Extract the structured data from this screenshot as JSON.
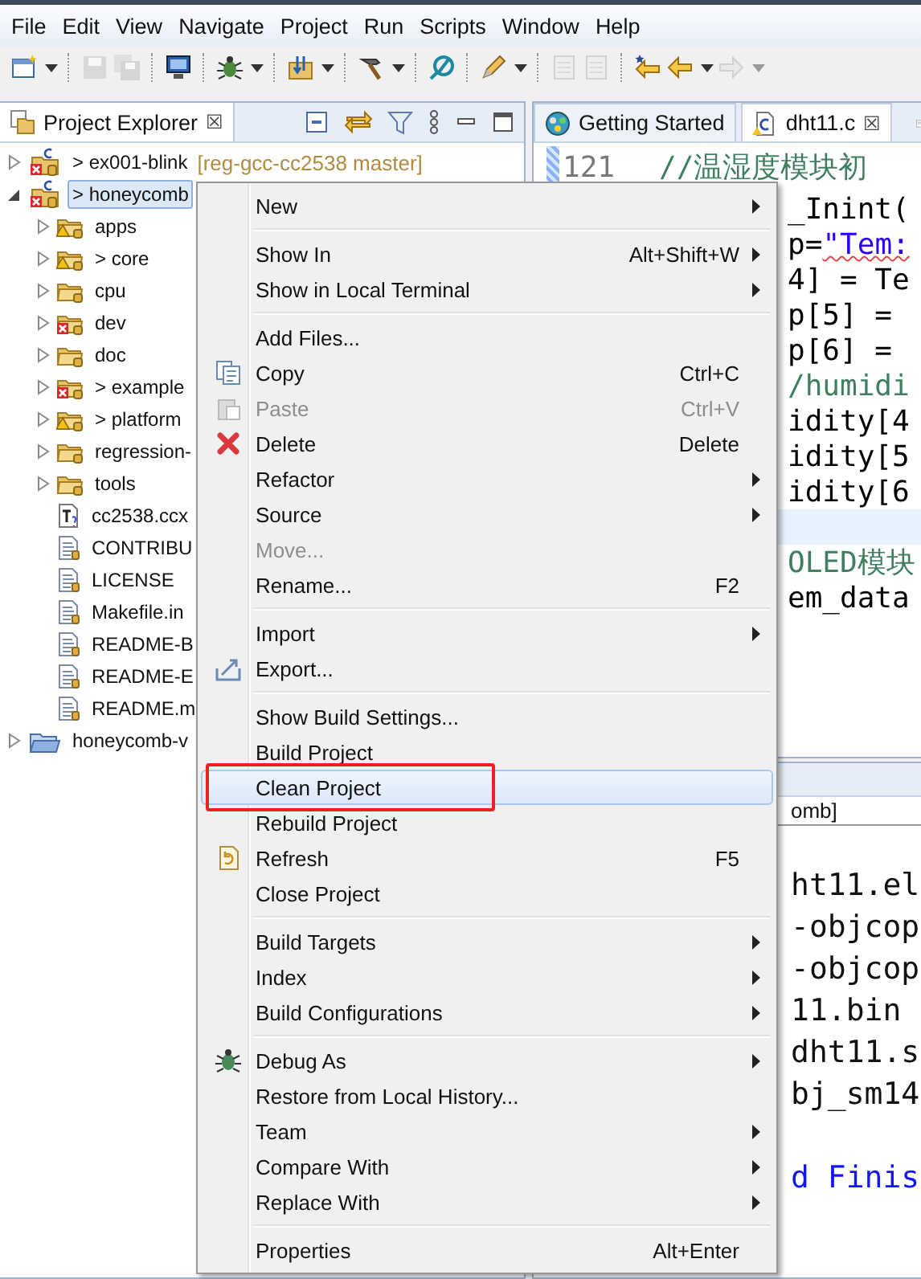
{
  "menubar": [
    "File",
    "Edit",
    "View",
    "Navigate",
    "Project",
    "Run",
    "Scripts",
    "Window",
    "Help"
  ],
  "toolbar": [
    {
      "kind": "button",
      "disabled": false,
      "dropdown": true
    },
    {
      "kind": "separator"
    },
    {
      "kind": "button",
      "disabled": true,
      "dropdown": false
    },
    {
      "kind": "button",
      "disabled": true,
      "dropdown": false
    },
    {
      "kind": "separator"
    },
    {
      "kind": "button",
      "disabled": false,
      "dropdown": false
    },
    {
      "kind": "separator"
    },
    {
      "kind": "button",
      "disabled": false,
      "dropdown": true
    },
    {
      "kind": "separator"
    },
    {
      "kind": "button",
      "disabled": false,
      "dropdown": true
    },
    {
      "kind": "separator"
    },
    {
      "kind": "button",
      "disabled": false,
      "dropdown": true
    },
    {
      "kind": "separator"
    },
    {
      "kind": "button",
      "disabled": false,
      "dropdown": false
    },
    {
      "kind": "separator"
    },
    {
      "kind": "button",
      "disabled": false,
      "dropdown": true
    },
    {
      "kind": "separator"
    },
    {
      "kind": "button",
      "disabled": true,
      "dropdown": false
    },
    {
      "kind": "button",
      "disabled": true,
      "dropdown": false
    },
    {
      "kind": "separator"
    },
    {
      "kind": "button",
      "disabled": false,
      "dropdown": false
    },
    {
      "kind": "button",
      "disabled": false,
      "dropdown": true
    },
    {
      "kind": "button",
      "disabled": true,
      "dropdown": true
    }
  ],
  "project_explorer": {
    "title": "Project Explorer",
    "close": "☒",
    "tree": [
      {
        "kind": "project",
        "label": "> ex001-blink",
        "decoration": "[reg-gcc-cc2538 master]",
        "expanded": false,
        "selected": false
      },
      {
        "kind": "project",
        "label": "> honeycomb",
        "expanded": true,
        "selected": true,
        "children": [
          {
            "kind": "folder",
            "error": false,
            "warning": true,
            "label": "apps",
            "expanded": false,
            "selected": false
          },
          {
            "kind": "folder",
            "error": false,
            "warning": true,
            "label": "> core",
            "expanded": false,
            "selected": false
          },
          {
            "kind": "folder",
            "error": false,
            "warning": false,
            "label": "cpu",
            "expanded": false,
            "selected": false
          },
          {
            "kind": "folder",
            "error": true,
            "warning": false,
            "label": "dev",
            "expanded": false,
            "selected": false
          },
          {
            "kind": "folder",
            "error": false,
            "warning": false,
            "label": "doc",
            "expanded": false,
            "selected": false
          },
          {
            "kind": "folder",
            "error": true,
            "warning": false,
            "label": "> example",
            "expanded": false,
            "selected": false
          },
          {
            "kind": "folder",
            "error": false,
            "warning": true,
            "label": "> platform",
            "expanded": false,
            "selected": false
          },
          {
            "kind": "folder",
            "error": false,
            "warning": false,
            "label": "regression-",
            "expanded": false,
            "selected": false
          },
          {
            "kind": "folder",
            "error": false,
            "warning": false,
            "label": "tools",
            "expanded": false,
            "selected": false
          },
          {
            "kind": "target",
            "label": "cc2538.ccx",
            "selected": false
          },
          {
            "kind": "file",
            "label": "CONTRIBU",
            "selected": false
          },
          {
            "kind": "file",
            "label": "LICENSE",
            "selected": false
          },
          {
            "kind": "file",
            "label": "Makefile.in",
            "selected": false
          },
          {
            "kind": "file",
            "label": "README-B",
            "selected": false
          },
          {
            "kind": "file",
            "label": "README-E",
            "selected": false
          },
          {
            "kind": "file",
            "label": "README.m",
            "selected": false
          }
        ]
      },
      {
        "kind": "open-project",
        "label": "honeycomb-v",
        "expanded": false,
        "selected": false
      }
    ]
  },
  "editor": {
    "tabs": [
      {
        "label": "Getting Started",
        "selected": false
      },
      {
        "label": "dht11.c",
        "close": "☒",
        "selected": true
      }
    ],
    "first_line": {
      "number": "121",
      "segments": [
        {
          "text": "//温湿度模块初",
          "kind": "comment"
        }
      ]
    },
    "lines": [
      {
        "segments": [
          {
            "text": "_Inint(",
            "kind": "code"
          }
        ],
        "current": false
      },
      {
        "segments": [
          {
            "text": "p=",
            "kind": "code"
          },
          {
            "text": "\"Tem:",
            "kind": "string"
          }
        ],
        "current": false
      },
      {
        "segments": [
          {
            "text": "4] = Te",
            "kind": "code"
          }
        ],
        "current": false
      },
      {
        "segments": [
          {
            "text": "p[5] = ",
            "kind": "code"
          }
        ],
        "current": false
      },
      {
        "segments": [
          {
            "text": "p[6] = ",
            "kind": "code"
          }
        ],
        "current": false
      },
      {
        "segments": [
          {
            "text": "/humidi",
            "kind": "comment"
          }
        ],
        "current": false
      },
      {
        "segments": [
          {
            "text": "idity[4",
            "kind": "code"
          }
        ],
        "current": false
      },
      {
        "segments": [
          {
            "text": "idity[5",
            "kind": "code"
          }
        ],
        "current": false
      },
      {
        "segments": [
          {
            "text": "idity[6",
            "kind": "code"
          }
        ],
        "current": false
      },
      {
        "current": true
      },
      {
        "segments": [
          {
            "text": "OLED模块",
            "kind": "comment"
          }
        ],
        "current": false
      },
      {
        "segments": [
          {
            "text": "em_data",
            "kind": "code"
          }
        ],
        "current": false
      }
    ]
  },
  "console": {
    "title": "omb]",
    "lines": [
      {
        "text": "ht11.el",
        "kind": "normal"
      },
      {
        "text": "-objcop",
        "kind": "normal"
      },
      {
        "text": "-objcop",
        "kind": "normal"
      },
      {
        "text": "11.bin",
        "kind": "normal"
      },
      {
        "text": "dht11.s",
        "kind": "normal"
      },
      {
        "text": "bj_sm14",
        "kind": "normal"
      },
      {
        "kind": "blank"
      },
      {
        "text": "d Finis",
        "kind": "info"
      }
    ]
  },
  "context_menu": [
    {
      "kind": "item",
      "label": "New",
      "submenu": true,
      "disabled": false,
      "selected": false
    },
    {
      "kind": "separator"
    },
    {
      "kind": "item",
      "label": "Show In",
      "shortcut": "Alt+Shift+W",
      "submenu": true,
      "disabled": false,
      "selected": false
    },
    {
      "kind": "item",
      "label": "Show in Local Terminal",
      "submenu": true,
      "disabled": false,
      "selected": false
    },
    {
      "kind": "separator"
    },
    {
      "kind": "item",
      "label": "Add Files...",
      "submenu": false,
      "disabled": false,
      "selected": false
    },
    {
      "kind": "item",
      "label": "Copy",
      "shortcut": "Ctrl+C",
      "submenu": false,
      "disabled": false,
      "selected": false
    },
    {
      "kind": "item",
      "label": "Paste",
      "shortcut": "Ctrl+V",
      "submenu": false,
      "disabled": true,
      "selected": false
    },
    {
      "kind": "item",
      "label": "Delete",
      "shortcut": "Delete",
      "submenu": false,
      "disabled": false,
      "selected": false
    },
    {
      "kind": "item",
      "label": "Refactor",
      "submenu": true,
      "disabled": false,
      "selected": false
    },
    {
      "kind": "item",
      "label": "Source",
      "submenu": true,
      "disabled": false,
      "selected": false
    },
    {
      "kind": "item",
      "label": "Move...",
      "submenu": false,
      "disabled": true,
      "selected": false
    },
    {
      "kind": "item",
      "label": "Rename...",
      "shortcut": "F2",
      "submenu": false,
      "disabled": false,
      "selected": false
    },
    {
      "kind": "separator"
    },
    {
      "kind": "item",
      "label": "Import",
      "submenu": true,
      "disabled": false,
      "selected": false
    },
    {
      "kind": "item",
      "label": "Export...",
      "submenu": false,
      "disabled": false,
      "selected": false
    },
    {
      "kind": "separator"
    },
    {
      "kind": "item",
      "label": "Show Build Settings...",
      "submenu": false,
      "disabled": false,
      "selected": false
    },
    {
      "kind": "item",
      "label": "Build Project",
      "submenu": false,
      "disabled": false,
      "selected": false
    },
    {
      "kind": "item",
      "label": "Clean Project",
      "submenu": false,
      "disabled": false,
      "selected": true,
      "annotated": true
    },
    {
      "kind": "item",
      "label": "Rebuild Project",
      "submenu": false,
      "disabled": false,
      "selected": false
    },
    {
      "kind": "item",
      "label": "Refresh",
      "shortcut": "F5",
      "submenu": false,
      "disabled": false,
      "selected": false
    },
    {
      "kind": "item",
      "label": "Close Project",
      "submenu": false,
      "disabled": false,
      "selected": false
    },
    {
      "kind": "separator"
    },
    {
      "kind": "item",
      "label": "Build Targets",
      "submenu": true,
      "disabled": false,
      "selected": false
    },
    {
      "kind": "item",
      "label": "Index",
      "submenu": true,
      "disabled": false,
      "selected": false
    },
    {
      "kind": "item",
      "label": "Build Configurations",
      "submenu": true,
      "disabled": false,
      "selected": false
    },
    {
      "kind": "separator"
    },
    {
      "kind": "item",
      "label": "Debug As",
      "submenu": true,
      "disabled": false,
      "selected": false
    },
    {
      "kind": "item",
      "label": "Restore from Local History...",
      "submenu": false,
      "disabled": false,
      "selected": false
    },
    {
      "kind": "item",
      "label": "Team",
      "submenu": true,
      "disabled": false,
      "selected": false
    },
    {
      "kind": "item",
      "label": "Compare With",
      "submenu": true,
      "disabled": false,
      "selected": false
    },
    {
      "kind": "item",
      "label": "Replace With",
      "submenu": true,
      "disabled": false,
      "selected": false
    },
    {
      "kind": "separator"
    },
    {
      "kind": "item",
      "label": "Properties",
      "shortcut": "Alt+Enter",
      "submenu": false,
      "disabled": false,
      "selected": false
    }
  ]
}
